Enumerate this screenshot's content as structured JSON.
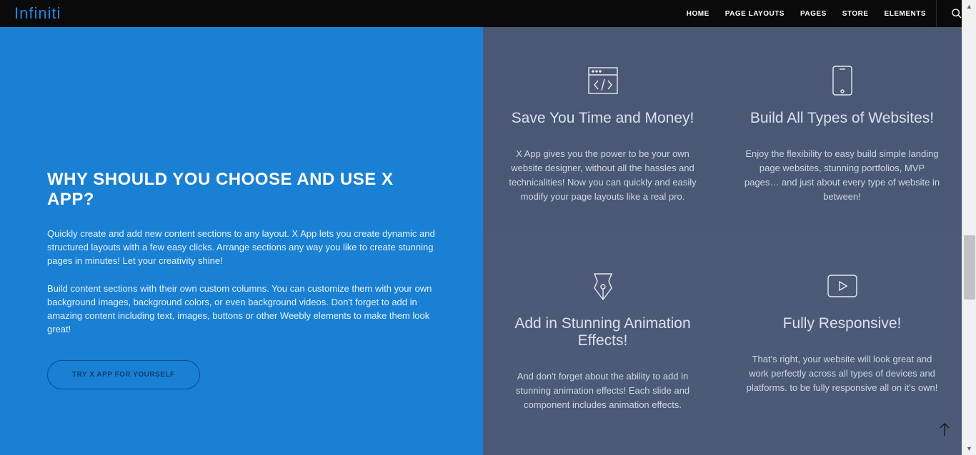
{
  "header": {
    "logo": "Infiniti",
    "nav": {
      "home": "HOME",
      "page_layouts": "PAGE LAYOUTS",
      "pages": "PAGES",
      "store": "STORE",
      "elements": "ELEMENTS"
    }
  },
  "hero": {
    "title": "WHY SHOULD YOU CHOOSE AND USE X APP?",
    "p1": "Quickly create and add new content sections to any layout. X App lets you create dynamic and structured layouts with a few easy clicks. Arrange sections any way you like to create stunning pages in minutes! Let your creativity shine!",
    "p2": "Build content sections with their own custom columns. You can customize them with your own background images, background colors, or even background videos. Don't forget to add in amazing content including text, images, buttons or other Weebly elements to make them look great!",
    "cta": "TRY X APP FOR YOURSELF"
  },
  "cards": {
    "c1": {
      "title": "Save You Time and Money!",
      "body": "X App gives you the power to be your own website designer, without all the hassles and technicalities! Now you can quickly and easily modify your page layouts like a real pro."
    },
    "c2": {
      "title": "Build All Types of Websites!",
      "body": "Enjoy the flexibility to easy build simple landing page websites, stunning portfolios, MVP pages… and just about every type of website in between!"
    },
    "c3": {
      "title": "Add in Stunning Animation Effects!",
      "body": "And don't forget about the ability to add in stunning animation effects! Each slide and component includes animation effects."
    },
    "c4": {
      "title": "Fully Responsive!",
      "body": "That's right, your website will look great and work perfectly across all types of devices and platforms. to be fully responsive all on it's own!"
    }
  }
}
